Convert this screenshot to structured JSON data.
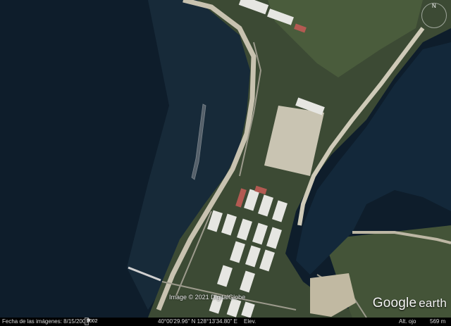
{
  "imagery": {
    "attribution": "Image © 2021 DigitalGlobe",
    "logo_google": "Google",
    "logo_earth": "earth"
  },
  "status_bar": {
    "imagery_date_label": "Fecha de las imágenes: 8/15/2009",
    "year_badge": "2002",
    "coordinates": "40°00'29.96\" N 128°13'34.80\" E",
    "elevation_label": "Elev.",
    "eye_alt_label": "Alt. ojo",
    "eye_alt_value": "569 m"
  },
  "colors": {
    "water": "#0e1d2b",
    "shallow_water": "#243b4a",
    "land": "#3c4a34",
    "beach": "#c8c2b0",
    "roofs": "#e6e6e2"
  }
}
